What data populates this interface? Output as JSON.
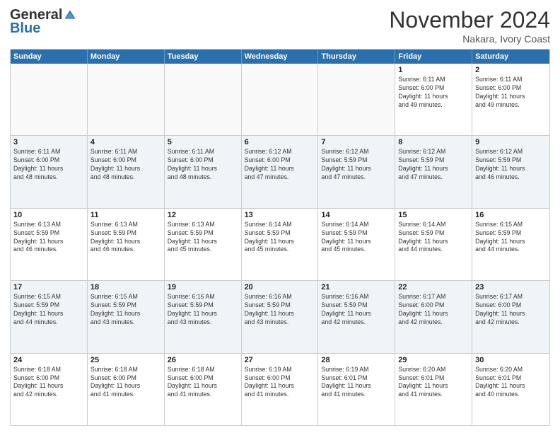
{
  "logo": {
    "general": "General",
    "blue": "Blue"
  },
  "header": {
    "month": "November 2024",
    "location": "Nakara, Ivory Coast"
  },
  "weekdays": [
    "Sunday",
    "Monday",
    "Tuesday",
    "Wednesday",
    "Thursday",
    "Friday",
    "Saturday"
  ],
  "rows": [
    [
      {
        "day": "",
        "info": ""
      },
      {
        "day": "",
        "info": ""
      },
      {
        "day": "",
        "info": ""
      },
      {
        "day": "",
        "info": ""
      },
      {
        "day": "",
        "info": ""
      },
      {
        "day": "1",
        "info": "Sunrise: 6:11 AM\nSunset: 6:00 PM\nDaylight: 11 hours\nand 49 minutes."
      },
      {
        "day": "2",
        "info": "Sunrise: 6:11 AM\nSunset: 6:00 PM\nDaylight: 11 hours\nand 49 minutes."
      }
    ],
    [
      {
        "day": "3",
        "info": "Sunrise: 6:11 AM\nSunset: 6:00 PM\nDaylight: 11 hours\nand 48 minutes."
      },
      {
        "day": "4",
        "info": "Sunrise: 6:11 AM\nSunset: 6:00 PM\nDaylight: 11 hours\nand 48 minutes."
      },
      {
        "day": "5",
        "info": "Sunrise: 6:11 AM\nSunset: 6:00 PM\nDaylight: 11 hours\nand 48 minutes."
      },
      {
        "day": "6",
        "info": "Sunrise: 6:12 AM\nSunset: 6:00 PM\nDaylight: 11 hours\nand 47 minutes."
      },
      {
        "day": "7",
        "info": "Sunrise: 6:12 AM\nSunset: 5:59 PM\nDaylight: 11 hours\nand 47 minutes."
      },
      {
        "day": "8",
        "info": "Sunrise: 6:12 AM\nSunset: 5:59 PM\nDaylight: 11 hours\nand 47 minutes."
      },
      {
        "day": "9",
        "info": "Sunrise: 6:12 AM\nSunset: 5:59 PM\nDaylight: 11 hours\nand 46 minutes."
      }
    ],
    [
      {
        "day": "10",
        "info": "Sunrise: 6:13 AM\nSunset: 5:59 PM\nDaylight: 11 hours\nand 46 minutes."
      },
      {
        "day": "11",
        "info": "Sunrise: 6:13 AM\nSunset: 5:59 PM\nDaylight: 11 hours\nand 46 minutes."
      },
      {
        "day": "12",
        "info": "Sunrise: 6:13 AM\nSunset: 5:59 PM\nDaylight: 11 hours\nand 45 minutes."
      },
      {
        "day": "13",
        "info": "Sunrise: 6:14 AM\nSunset: 5:59 PM\nDaylight: 11 hours\nand 45 minutes."
      },
      {
        "day": "14",
        "info": "Sunrise: 6:14 AM\nSunset: 5:59 PM\nDaylight: 11 hours\nand 45 minutes."
      },
      {
        "day": "15",
        "info": "Sunrise: 6:14 AM\nSunset: 5:59 PM\nDaylight: 11 hours\nand 44 minutes."
      },
      {
        "day": "16",
        "info": "Sunrise: 6:15 AM\nSunset: 5:59 PM\nDaylight: 11 hours\nand 44 minutes."
      }
    ],
    [
      {
        "day": "17",
        "info": "Sunrise: 6:15 AM\nSunset: 5:59 PM\nDaylight: 11 hours\nand 44 minutes."
      },
      {
        "day": "18",
        "info": "Sunrise: 6:15 AM\nSunset: 5:59 PM\nDaylight: 11 hours\nand 43 minutes."
      },
      {
        "day": "19",
        "info": "Sunrise: 6:16 AM\nSunset: 5:59 PM\nDaylight: 11 hours\nand 43 minutes."
      },
      {
        "day": "20",
        "info": "Sunrise: 6:16 AM\nSunset: 5:59 PM\nDaylight: 11 hours\nand 43 minutes."
      },
      {
        "day": "21",
        "info": "Sunrise: 6:16 AM\nSunset: 5:59 PM\nDaylight: 11 hours\nand 42 minutes."
      },
      {
        "day": "22",
        "info": "Sunrise: 6:17 AM\nSunset: 6:00 PM\nDaylight: 11 hours\nand 42 minutes."
      },
      {
        "day": "23",
        "info": "Sunrise: 6:17 AM\nSunset: 6:00 PM\nDaylight: 11 hours\nand 42 minutes."
      }
    ],
    [
      {
        "day": "24",
        "info": "Sunrise: 6:18 AM\nSunset: 6:00 PM\nDaylight: 11 hours\nand 42 minutes."
      },
      {
        "day": "25",
        "info": "Sunrise: 6:18 AM\nSunset: 6:00 PM\nDaylight: 11 hours\nand 41 minutes."
      },
      {
        "day": "26",
        "info": "Sunrise: 6:18 AM\nSunset: 6:00 PM\nDaylight: 11 hours\nand 41 minutes."
      },
      {
        "day": "27",
        "info": "Sunrise: 6:19 AM\nSunset: 6:00 PM\nDaylight: 11 hours\nand 41 minutes."
      },
      {
        "day": "28",
        "info": "Sunrise: 6:19 AM\nSunset: 6:01 PM\nDaylight: 11 hours\nand 41 minutes."
      },
      {
        "day": "29",
        "info": "Sunrise: 6:20 AM\nSunset: 6:01 PM\nDaylight: 11 hours\nand 41 minutes."
      },
      {
        "day": "30",
        "info": "Sunrise: 6:20 AM\nSunset: 6:01 PM\nDaylight: 11 hours\nand 40 minutes."
      }
    ]
  ]
}
